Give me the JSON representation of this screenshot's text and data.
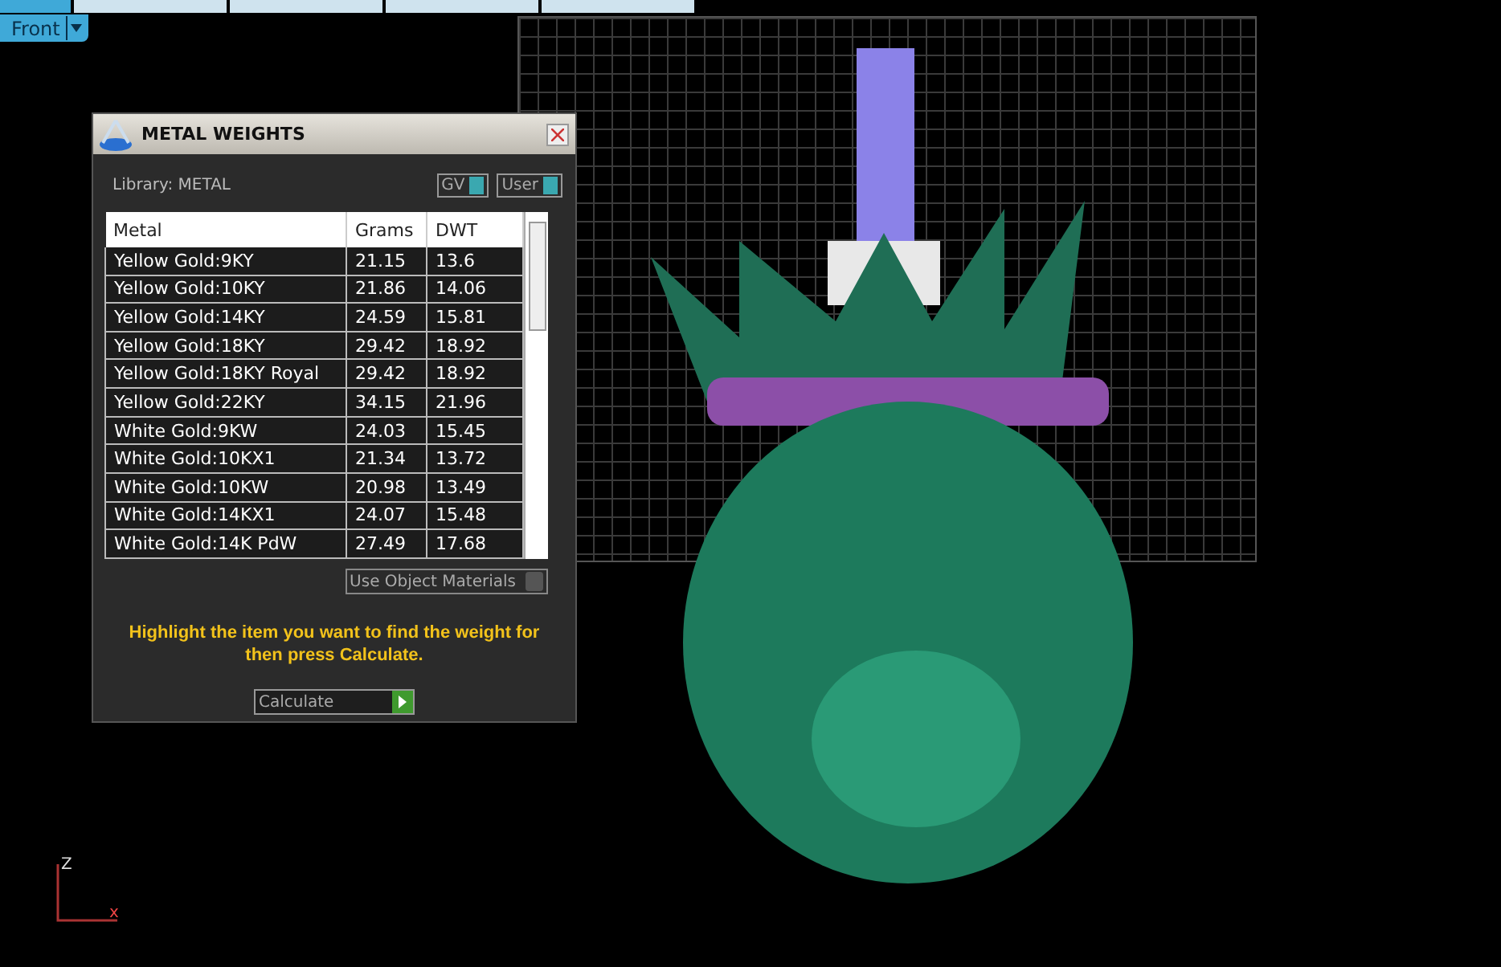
{
  "view_tabs": [
    {
      "selected": true
    },
    {
      "selected": false
    },
    {
      "selected": false
    },
    {
      "selected": false
    },
    {
      "selected": false
    }
  ],
  "view_selector": {
    "value": "Front"
  },
  "panel": {
    "title": "METAL WEIGHTS",
    "library": "Library: METAL",
    "toggles": [
      {
        "label": "GV",
        "on": true
      },
      {
        "label": "User",
        "on": true
      }
    ],
    "table": {
      "columns": [
        "Metal",
        "Grams",
        "DWT"
      ],
      "rows": [
        {
          "metal": "Yellow Gold:9KY",
          "grams": "21.15",
          "dwt": "13.6"
        },
        {
          "metal": "Yellow Gold:10KY",
          "grams": "21.86",
          "dwt": "14.06"
        },
        {
          "metal": "Yellow Gold:14KY",
          "grams": "24.59",
          "dwt": "15.81"
        },
        {
          "metal": "Yellow Gold:18KY",
          "grams": "29.42",
          "dwt": "18.92"
        },
        {
          "metal": "Yellow Gold:18KY Royal",
          "grams": "29.42",
          "dwt": "18.92"
        },
        {
          "metal": "Yellow Gold:22KY",
          "grams": "34.15",
          "dwt": "21.96"
        },
        {
          "metal": "White Gold:9KW",
          "grams": "24.03",
          "dwt": "15.45"
        },
        {
          "metal": "White Gold:10KX1",
          "grams": "21.34",
          "dwt": "13.72"
        },
        {
          "metal": "White Gold:10KW",
          "grams": "20.98",
          "dwt": "13.49"
        },
        {
          "metal": "White Gold:14KX1",
          "grams": "24.07",
          "dwt": "15.48"
        },
        {
          "metal": "White Gold:14K PdW",
          "grams": "27.49",
          "dwt": "17.68"
        }
      ]
    },
    "use_object_materials": {
      "label": "Use Object Materials",
      "checked": false
    },
    "hint": "Highlight the item you want to find the weight for then press Calculate.",
    "calculate_button": "Calculate"
  },
  "axes": {
    "z": "Z",
    "x": "x"
  }
}
